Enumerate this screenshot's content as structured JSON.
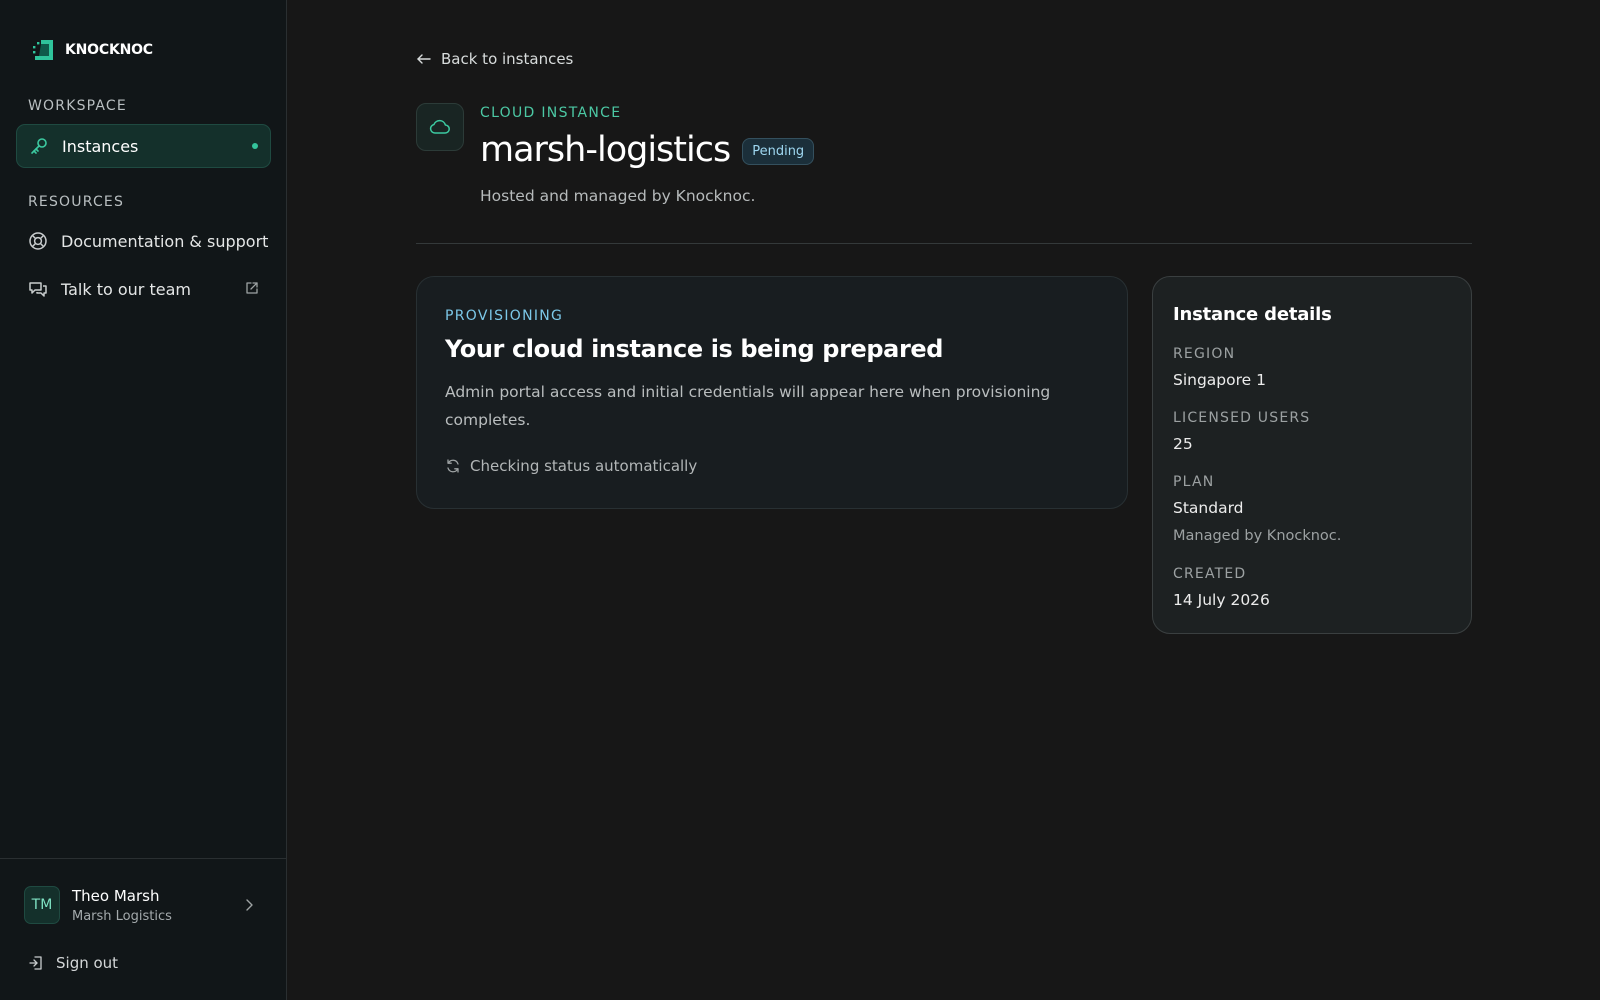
{
  "brand": {
    "name": "KNOCKNOC",
    "accent": "#34c39b"
  },
  "sidebar": {
    "workspace_label": "WORKSPACE",
    "resources_label": "RESOURCES",
    "items": [
      {
        "label": "Instances",
        "icon": "key-icon",
        "active": true
      },
      {
        "label": "Documentation & support",
        "icon": "lifebuoy-icon"
      },
      {
        "label": "Talk to our team",
        "icon": "chat-bubbles-icon",
        "external": true
      }
    ],
    "user": {
      "initials": "TM",
      "name": "Theo Marsh",
      "org": "Marsh Logistics"
    },
    "signout_label": "Sign out"
  },
  "header": {
    "back_label": "Back to instances",
    "eyebrow": "CLOUD INSTANCE",
    "title": "marsh-logistics",
    "status": "Pending",
    "subtitle": "Hosted and managed by Knocknoc."
  },
  "provisioning": {
    "eyebrow": "PROVISIONING",
    "title": "Your cloud instance is being prepared",
    "body": "Admin portal access and initial credentials will appear here when provisioning completes.",
    "status": "Checking status automatically"
  },
  "details": {
    "title": "Instance details",
    "region_label": "REGION",
    "region": "Singapore 1",
    "users_label": "LICENSED USERS",
    "users": "25",
    "plan_label": "PLAN",
    "plan": "Standard",
    "plan_note": "Managed by Knocknoc.",
    "created_label": "CREATED",
    "created": "14 July 2026"
  }
}
